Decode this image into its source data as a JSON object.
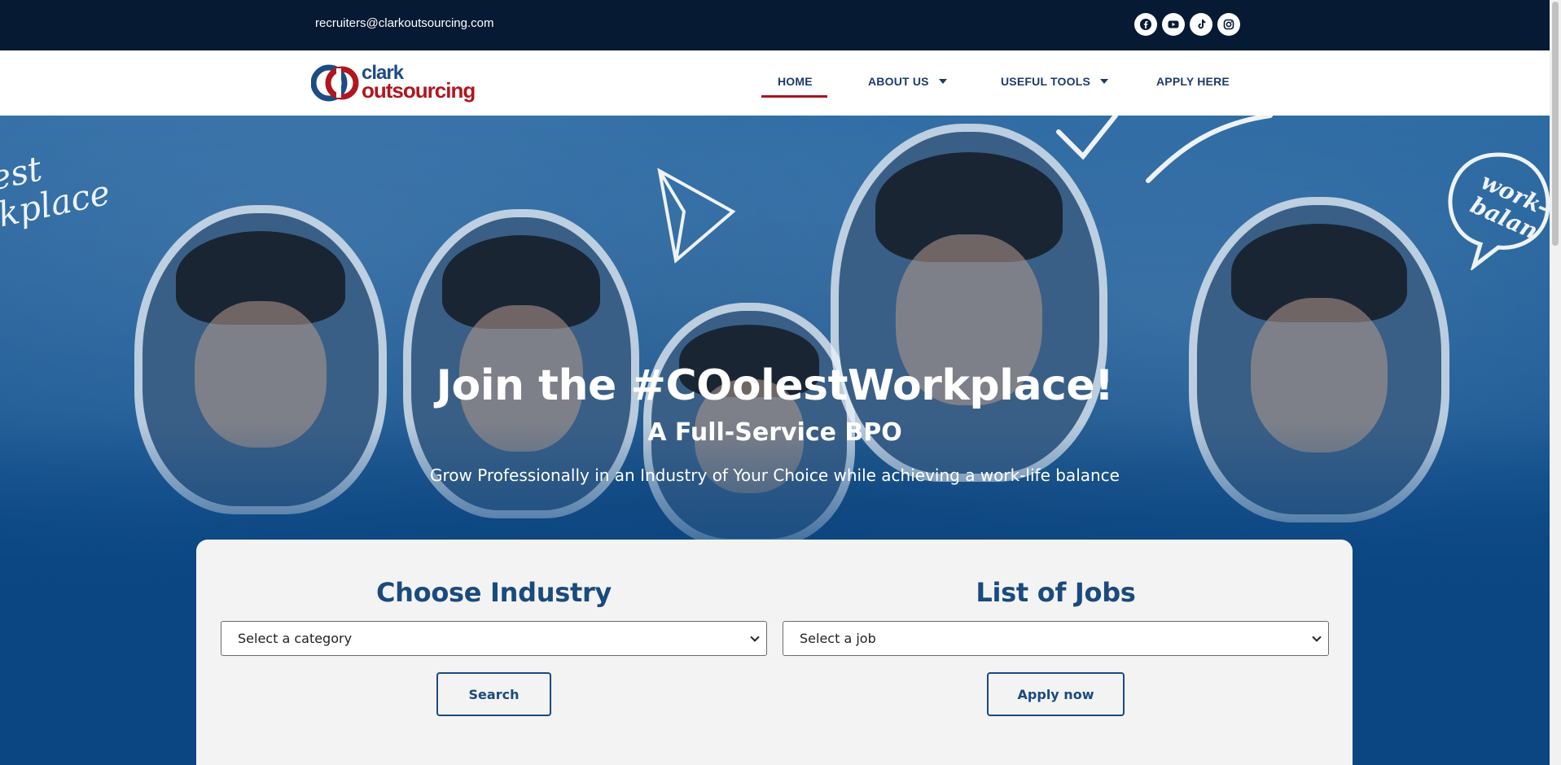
{
  "topbar": {
    "email": "recruiters@clarkoutsourcing.com",
    "socials": [
      {
        "name": "facebook-icon"
      },
      {
        "name": "youtube-icon"
      },
      {
        "name": "tiktok-icon"
      },
      {
        "name": "instagram-icon"
      }
    ]
  },
  "header": {
    "logo_line1": "clark",
    "logo_line2": "outsourcing",
    "nav": [
      {
        "label": "HOME",
        "active": true
      },
      {
        "label": "ABOUT US",
        "dropdown": true
      },
      {
        "label": "USEFUL TOOLS",
        "dropdown": true
      },
      {
        "label": "APPLY HERE"
      }
    ]
  },
  "hero": {
    "title": "Join the #COolestWorkplace!",
    "subtitle": "A Full-Service BPO",
    "description": "Grow Professionally in an Industry of Your Choice while achieving a work-life balance",
    "doodle_left": "est\nkplace",
    "doodle_right": "work-\nbalan"
  },
  "search": {
    "industry_heading": "Choose Industry",
    "industry_select": "Select a category",
    "search_button": "Search",
    "jobs_heading": "List of Jobs",
    "jobs_select": "Select a job",
    "apply_button": "Apply now"
  },
  "colors": {
    "topbar": "#061a33",
    "brand_blue": "#1a4a7e",
    "brand_red": "#a8141f",
    "hero_blue": "#0b4682"
  }
}
